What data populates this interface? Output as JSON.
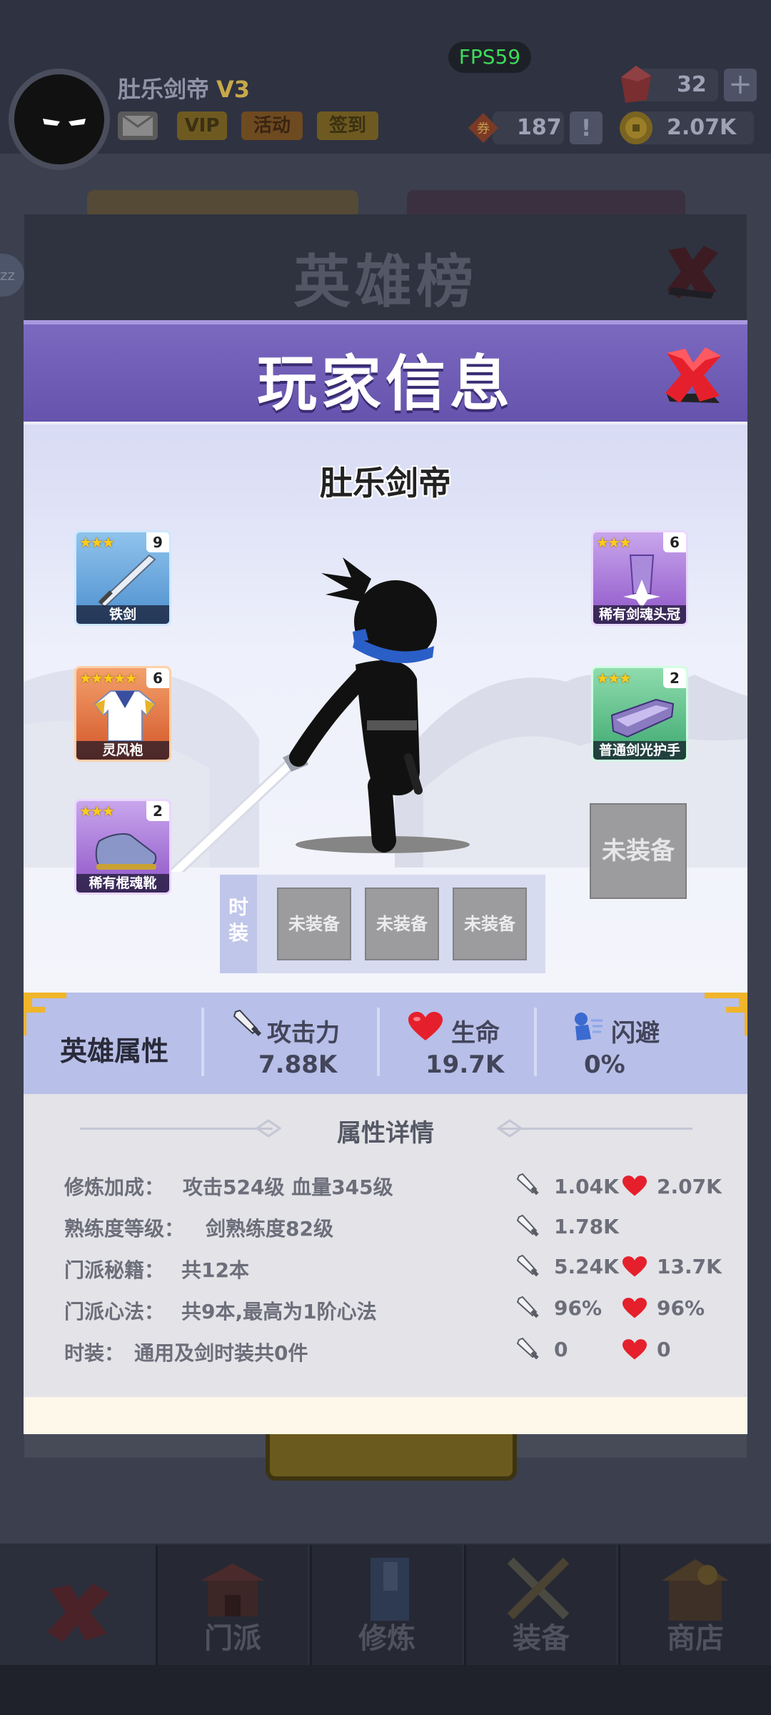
{
  "hud": {
    "fps": "FPS59",
    "player_name": "肚乐剑帝",
    "vip_level": "V3",
    "chips": [
      "VIP",
      "活动",
      "签到"
    ],
    "gems": "32",
    "tickets": "187",
    "coins": "2.07K",
    "side_badge": "zz"
  },
  "rank_panel": {
    "title": "英雄榜"
  },
  "nav": [
    "门派",
    "修炼",
    "装备",
    "商店"
  ],
  "dialog": {
    "title": "玩家信息",
    "player_name": "肚乐剑帝",
    "equipment": [
      {
        "name": "铁剑",
        "stars": "★★★",
        "level": "9",
        "rarity": "blue"
      },
      {
        "name": "灵风袍",
        "stars": "★★★★★",
        "level": "6",
        "rarity": "orange"
      },
      {
        "name": "稀有棍魂靴",
        "stars": "★★★",
        "level": "2",
        "rarity": "purple"
      },
      {
        "name": "稀有剑魂头冠",
        "stars": "★★★",
        "level": "6",
        "rarity": "purple"
      },
      {
        "name": "普通剑光护手",
        "stars": "★★★",
        "level": "2",
        "rarity": "green"
      }
    ],
    "empty_slot": "未装备",
    "fashion_label": "时装",
    "fashion_slots": [
      "未装备",
      "未装备",
      "未装备"
    ]
  },
  "attributes": {
    "title": "英雄属性",
    "attack_label": "攻击力",
    "attack_value": "7.88K",
    "hp_label": "生命",
    "hp_value": "19.7K",
    "dodge_label": "闪避",
    "dodge_value": "0%"
  },
  "details": {
    "title": "属性详情",
    "rows": [
      {
        "label": "修炼加成：",
        "value": "攻击524级 血量345级",
        "atk": "1.04K",
        "hp": "2.07K"
      },
      {
        "label": "熟练度等级：",
        "value": "剑熟练度82级",
        "atk": "1.78K",
        "hp": ""
      },
      {
        "label": "门派秘籍：",
        "value": "共12本",
        "atk": "5.24K",
        "hp": "13.7K"
      },
      {
        "label": "门派心法：",
        "value": "共9本,最高为1阶心法",
        "atk": "96%",
        "hp": "96%"
      },
      {
        "label": "时装：",
        "value": "通用及剑时装共0件",
        "atk": "0",
        "hp": "0"
      }
    ]
  },
  "colors": {
    "header_purple": "#6a58b2",
    "attr_bar": "#b8bfe8",
    "fps_green": "#3ddc5a",
    "heart_red": "#e5202c"
  }
}
